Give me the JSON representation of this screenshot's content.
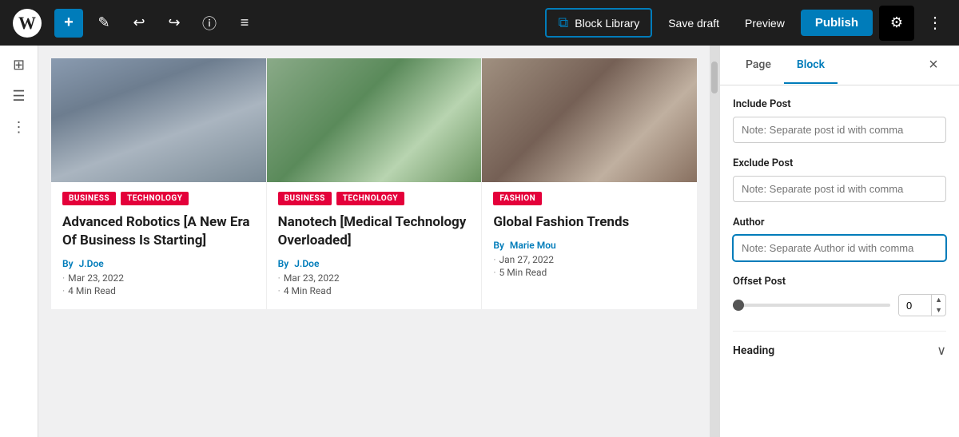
{
  "toolbar": {
    "wp_logo": "W",
    "add_label": "+",
    "edit_icon": "✎",
    "undo_icon": "↩",
    "redo_icon": "↪",
    "info_icon": "ⓘ",
    "list_icon": "≡",
    "block_library_label": "Block Library",
    "save_draft_label": "Save draft",
    "preview_label": "Preview",
    "publish_label": "Publish",
    "settings_icon": "⚙",
    "more_icon": "⋮"
  },
  "left_sidebar": {
    "grid_icon": "⊞",
    "hamburger_icon": "☰",
    "more_icon": "⋮"
  },
  "cards": [
    {
      "tags": [
        "BUSINESS",
        "TECHNOLOGY"
      ],
      "title": "Advanced Robotics [A New Era Of Business Is Starting]",
      "author_label": "By",
      "author": "J.Doe",
      "date": "Mar 23, 2022",
      "read_time": "4 Min Read",
      "img_class": "img-business"
    },
    {
      "tags": [
        "BUSINESS",
        "TECHNOLOGY"
      ],
      "title": "Nanotech [Medical Technology Overloaded]",
      "author_label": "By",
      "author": "J.Doe",
      "date": "Mar 23, 2022",
      "read_time": "4 Min Read",
      "img_class": "img-nano"
    },
    {
      "tags": [
        "FASHION"
      ],
      "title": "Global Fashion Trends",
      "author_label": "By",
      "author": "Marie Mou",
      "date": "Jan 27, 2022",
      "read_time": "5 Min Read",
      "img_class": "img-fashion"
    }
  ],
  "right_panel": {
    "tab_page": "Page",
    "tab_block": "Block",
    "close_icon": "×",
    "include_post_label": "Include Post",
    "include_post_placeholder": "Note: Separate post id with comma",
    "exclude_post_label": "Exclude Post",
    "exclude_post_placeholder": "Note: Separate post id with comma",
    "author_label": "Author",
    "author_placeholder": "Note: Separate Author id with comma",
    "offset_label": "Offset Post",
    "offset_value": "0",
    "heading_label": "Heading",
    "chevron_down": "∨"
  }
}
